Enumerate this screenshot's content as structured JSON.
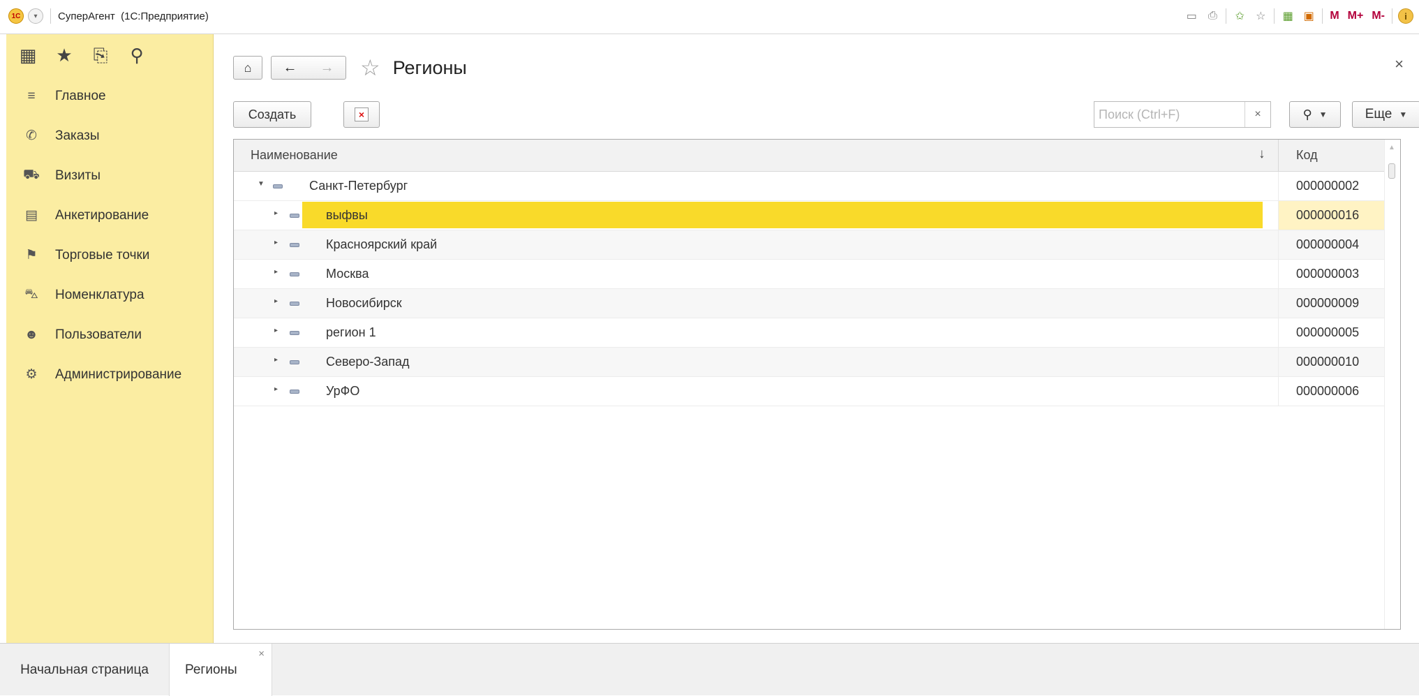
{
  "titlebar": {
    "app_title": "СуперАгент  (1С:Предприятие)",
    "m_label": "M",
    "m_plus_label": "M+",
    "m_minus_label": "M-"
  },
  "sidebar": {
    "tools": [
      {
        "icon": "apps-grid-icon",
        "glyph": "▦"
      },
      {
        "icon": "favorites-star-icon",
        "glyph": "★"
      },
      {
        "icon": "history-icon",
        "glyph": "⎘"
      },
      {
        "icon": "search-icon",
        "glyph": "⚲"
      }
    ],
    "items": [
      {
        "label": "Главное",
        "icon": "menu-lines-icon",
        "glyph": "≡"
      },
      {
        "label": "Заказы",
        "icon": "phone-icon",
        "glyph": "✆"
      },
      {
        "label": "Визиты",
        "icon": "car-icon",
        "glyph": "⛟"
      },
      {
        "label": "Анкетирование",
        "icon": "clipboard-icon",
        "glyph": "▤"
      },
      {
        "label": "Торговые точки",
        "icon": "flag-icon",
        "glyph": "⚑"
      },
      {
        "label": "Номенклатура",
        "icon": "cart-icon",
        "glyph": "⛍"
      },
      {
        "label": "Пользователи",
        "icon": "users-icon",
        "glyph": "☻"
      },
      {
        "label": "Администрирование",
        "icon": "gear-icon",
        "glyph": "⚙"
      }
    ]
  },
  "main": {
    "title": "Регионы",
    "create_label": "Создать",
    "search": {
      "placeholder": "Поиск (Ctrl+F)",
      "value": ""
    },
    "more_label": "Еще",
    "close_glyph": "×"
  },
  "table": {
    "columns": {
      "name": "Наименование",
      "code": "Код",
      "sort_glyph": "↓"
    },
    "rows": [
      {
        "name": "Санкт-Петербург",
        "code": "000000002",
        "level": 0,
        "expanded": true,
        "selected": false
      },
      {
        "name": "выфвы",
        "code": "000000016",
        "level": 1,
        "expanded": false,
        "selected": true
      },
      {
        "name": "Красноярский край",
        "code": "000000004",
        "level": 1,
        "expanded": false,
        "selected": false
      },
      {
        "name": "Москва",
        "code": "000000003",
        "level": 1,
        "expanded": false,
        "selected": false
      },
      {
        "name": "Новосибирск",
        "code": "000000009",
        "level": 1,
        "expanded": false,
        "selected": false
      },
      {
        "name": "регион 1",
        "code": "000000005",
        "level": 1,
        "expanded": false,
        "selected": false
      },
      {
        "name": "Северо-Запад",
        "code": "000000010",
        "level": 1,
        "expanded": false,
        "selected": false
      },
      {
        "name": "УрФО",
        "code": "000000006",
        "level": 1,
        "expanded": false,
        "selected": false
      }
    ]
  },
  "bottom_tabs": [
    {
      "label": "Начальная страница",
      "active": false
    },
    {
      "label": "Регионы",
      "active": true
    }
  ],
  "colors": {
    "sidebar_bg": "#fbeda2",
    "selection": "#f9da2a",
    "accent_red": "#b3003b"
  }
}
